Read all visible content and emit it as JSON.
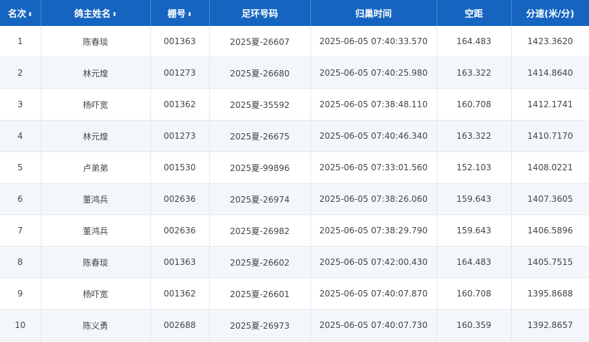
{
  "headers": [
    "名次",
    "鸽主姓名",
    "棚号",
    "足环号码",
    "归巢时间",
    "空距",
    "分速(米/分)"
  ],
  "sort_icon": "⬍",
  "rows": [
    [
      "1",
      "陈春琰",
      "001363",
      "2025夏-26607",
      "2025-06-05 07:40:33.570",
      "164.483",
      "1423.3620"
    ],
    [
      "2",
      "林元煌",
      "001273",
      "2025夏-26680",
      "2025-06-05 07:40:25.980",
      "163.322",
      "1414.8640"
    ],
    [
      "3",
      "杨吓宽",
      "001362",
      "2025夏-35592",
      "2025-06-05 07:38:48.110",
      "160.708",
      "1412.1741"
    ],
    [
      "4",
      "林元煌",
      "001273",
      "2025夏-26675",
      "2025-06-05 07:40:46.340",
      "163.322",
      "1410.7170"
    ],
    [
      "5",
      "卢弟弟",
      "001530",
      "2025夏-99896",
      "2025-06-05 07:33:01.560",
      "152.103",
      "1408.0221"
    ],
    [
      "6",
      "董鸿兵",
      "002636",
      "2025夏-26974",
      "2025-06-05 07:38:26.060",
      "159.643",
      "1407.3605"
    ],
    [
      "7",
      "董鸿兵",
      "002636",
      "2025夏-26982",
      "2025-06-05 07:38:29.790",
      "159.643",
      "1406.5896"
    ],
    [
      "8",
      "陈春琰",
      "001363",
      "2025夏-26602",
      "2025-06-05 07:42:00.430",
      "164.483",
      "1405.7515"
    ],
    [
      "9",
      "杨吓宽",
      "001362",
      "2025夏-26601",
      "2025-06-05 07:40:07.870",
      "160.708",
      "1395.8688"
    ],
    [
      "10",
      "陈义勇",
      "002688",
      "2025夏-26973",
      "2025-06-05 07:40:07.730",
      "160.359",
      "1392.8657"
    ]
  ]
}
